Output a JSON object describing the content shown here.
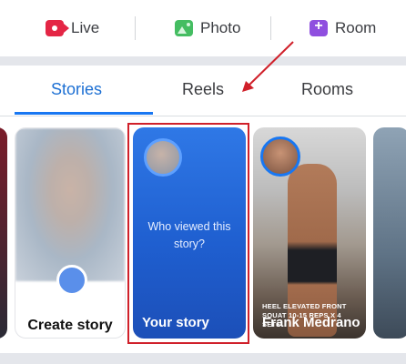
{
  "composer_actions": {
    "live_label": "Live",
    "photo_label": "Photo",
    "room_label": "Room"
  },
  "tabs": {
    "items": [
      "Stories",
      "Reels",
      "Rooms"
    ],
    "active": "Stories"
  },
  "stories": {
    "create": {
      "label": "Create story"
    },
    "your_story": {
      "question": "Who viewed this story?",
      "label": "Your story"
    },
    "friend": {
      "name": "Frank Medrano",
      "caption": "HEEL ELEVATED FRONT SQUAT 10-15 REPS X 4 SETS"
    }
  },
  "colors": {
    "accent": "#1877f2",
    "annotation": "#d0202a",
    "live": "#e42645",
    "photo": "#45bd62",
    "room": "#8f4fdf"
  },
  "icons": [
    "live-video-icon",
    "photo-icon",
    "room-icon"
  ]
}
